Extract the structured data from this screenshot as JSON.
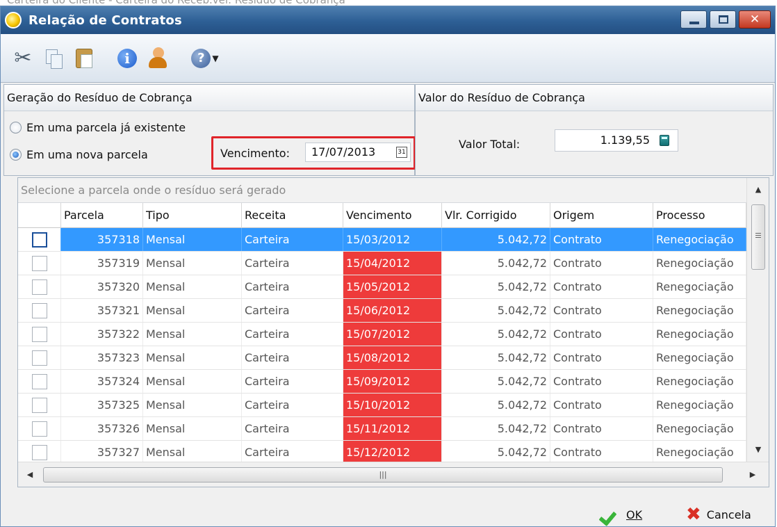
{
  "behind_caption": "Carteira do Cliente - Carteira do Receb.vel: Resíduo de Cobrança",
  "window": {
    "title": "Relação de Contratos"
  },
  "generation_panel": {
    "title": "Geração do Resíduo de Cobrança",
    "option_existing": "Em uma parcela já existente",
    "option_new": "Em uma nova parcela",
    "selected_option": "new",
    "due_label": "Vencimento:",
    "due_value": "17/07/2013"
  },
  "value_panel": {
    "title": "Valor do Resíduo de Cobrança",
    "total_label": "Valor Total:",
    "total_value": "1.139,55"
  },
  "grid": {
    "caption": "Selecione a parcela onde o resíduo será gerado",
    "columns": [
      "",
      "Parcela",
      "Tipo",
      "Receita",
      "Vencimento",
      "Vlr. Corrigido",
      "Origem",
      "Processo"
    ],
    "rows": [
      {
        "parcela": "357318",
        "tipo": "Mensal",
        "receita": "Carteira",
        "vencimento": "15/03/2012",
        "valor": "5.042,72",
        "origem": "Contrato",
        "processo": "Renegociação"
      },
      {
        "parcela": "357319",
        "tipo": "Mensal",
        "receita": "Carteira",
        "vencimento": "15/04/2012",
        "valor": "5.042,72",
        "origem": "Contrato",
        "processo": "Renegociação"
      },
      {
        "parcela": "357320",
        "tipo": "Mensal",
        "receita": "Carteira",
        "vencimento": "15/05/2012",
        "valor": "5.042,72",
        "origem": "Contrato",
        "processo": "Renegociação"
      },
      {
        "parcela": "357321",
        "tipo": "Mensal",
        "receita": "Carteira",
        "vencimento": "15/06/2012",
        "valor": "5.042,72",
        "origem": "Contrato",
        "processo": "Renegociação"
      },
      {
        "parcela": "357322",
        "tipo": "Mensal",
        "receita": "Carteira",
        "vencimento": "15/07/2012",
        "valor": "5.042,72",
        "origem": "Contrato",
        "processo": "Renegociação"
      },
      {
        "parcela": "357323",
        "tipo": "Mensal",
        "receita": "Carteira",
        "vencimento": "15/08/2012",
        "valor": "5.042,72",
        "origem": "Contrato",
        "processo": "Renegociação"
      },
      {
        "parcela": "357324",
        "tipo": "Mensal",
        "receita": "Carteira",
        "vencimento": "15/09/2012",
        "valor": "5.042,72",
        "origem": "Contrato",
        "processo": "Renegociação"
      },
      {
        "parcela": "357325",
        "tipo": "Mensal",
        "receita": "Carteira",
        "vencimento": "15/10/2012",
        "valor": "5.042,72",
        "origem": "Contrato",
        "processo": "Renegociação"
      },
      {
        "parcela": "357326",
        "tipo": "Mensal",
        "receita": "Carteira",
        "vencimento": "15/11/2012",
        "valor": "5.042,72",
        "origem": "Contrato",
        "processo": "Renegociação"
      },
      {
        "parcela": "357327",
        "tipo": "Mensal",
        "receita": "Carteira",
        "vencimento": "15/12/2012",
        "valor": "5.042,72",
        "origem": "Contrato",
        "processo": "Renegociação"
      }
    ]
  },
  "buttons": {
    "ok": "OK",
    "cancel": "Cancela"
  },
  "colors": {
    "selection": "#3399ff",
    "overdue": "#ee3b3b",
    "highlight_box": "#e0242a"
  }
}
